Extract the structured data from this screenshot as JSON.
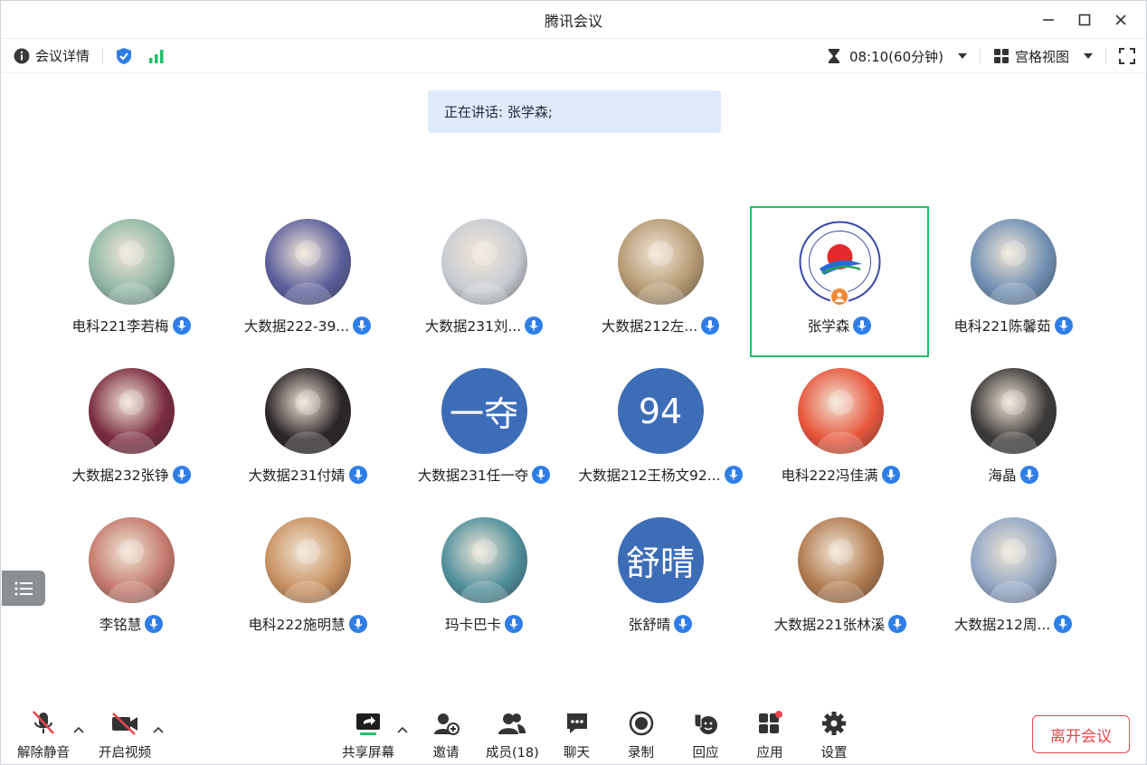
{
  "window": {
    "title": "腾讯会议"
  },
  "infobar": {
    "meeting_details": "会议详情",
    "timer": "08:10(60分钟)",
    "view_mode": "宫格视图"
  },
  "speaking": {
    "text": "正在讲话: 张学森;"
  },
  "participants": [
    {
      "name": "电科221李若梅",
      "avatar": "photo",
      "avatar_color": "#8fb7a6"
    },
    {
      "name": "大数据222-39...",
      "avatar": "photo",
      "avatar_color": "#5b5f9c"
    },
    {
      "name": "大数据231刘...",
      "avatar": "photo",
      "avatar_color": "#c7ccd3"
    },
    {
      "name": "大数据212左...",
      "avatar": "photo",
      "avatar_color": "#b59a72"
    },
    {
      "name": "张学森",
      "avatar": "logo",
      "avatar_color": "#ffffff",
      "host": true,
      "active": true
    },
    {
      "name": "电科221陈馨茹",
      "avatar": "photo",
      "avatar_color": "#6f8fb3"
    },
    {
      "name": "大数据232张铮",
      "avatar": "photo",
      "avatar_color": "#7a2b3f"
    },
    {
      "name": "大数据231付婧",
      "avatar": "photo",
      "avatar_color": "#2b2528"
    },
    {
      "name": "大数据231任一夺",
      "avatar": "text",
      "avatar_text": "一夺",
      "avatar_color": "#3d6db7"
    },
    {
      "name": "大数据212王杨文92...",
      "avatar": "text",
      "avatar_text": "94",
      "avatar_color": "#3d6db7"
    },
    {
      "name": "电科222冯佳满",
      "avatar": "photo",
      "avatar_color": "#e8553c"
    },
    {
      "name": "海晶",
      "avatar": "photo",
      "avatar_color": "#3c3a39"
    },
    {
      "name": "李铭慧",
      "avatar": "photo",
      "avatar_color": "#c47a6c"
    },
    {
      "name": "电科222施明慧",
      "avatar": "photo",
      "avatar_color": "#c99060"
    },
    {
      "name": "玛卡巴卡",
      "avatar": "photo",
      "avatar_color": "#4e8f9b"
    },
    {
      "name": "张舒晴",
      "avatar": "text",
      "avatar_text": "舒晴",
      "avatar_color": "#3d6db7"
    },
    {
      "name": "大数据221张林溪",
      "avatar": "photo",
      "avatar_color": "#b07a4f"
    },
    {
      "name": "大数据212周...",
      "avatar": "photo",
      "avatar_color": "#8fa6c4"
    }
  ],
  "toolbar": {
    "unmute": "解除静音",
    "start_video": "开启视频",
    "share_screen": "共享屏幕",
    "invite": "邀请",
    "members": "成员(18)",
    "chat": "聊天",
    "record": "录制",
    "react": "回应",
    "apps": "应用",
    "settings": "设置",
    "leave": "离开会议"
  },
  "colors": {
    "accent": "#2f7ee8",
    "active_border": "#1ec26a",
    "leave": "#e5484d",
    "speaking_bg": "#dceafc"
  }
}
